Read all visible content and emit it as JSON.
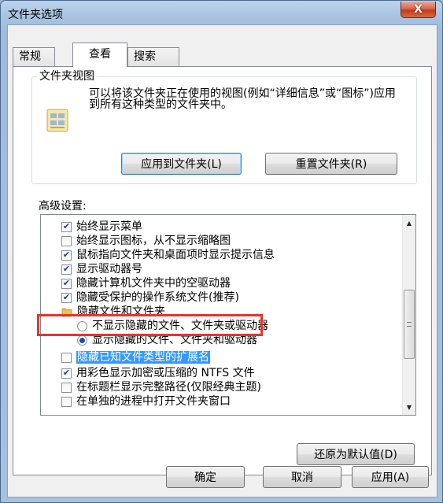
{
  "window": {
    "title": "文件夹选项",
    "close_glyph": "X"
  },
  "tabs": [
    {
      "label": "常规",
      "active": false
    },
    {
      "label": "查看",
      "active": true
    },
    {
      "label": "搜索",
      "active": false
    }
  ],
  "folder_view": {
    "title": "文件夹视图",
    "description": "可以将该文件夹正在使用的视图(例如“详细信息”或“图标”)应用到所有这种类型的文件夹中。",
    "apply_button": "应用到文件夹(L)",
    "reset_button": "重置文件夹(R)"
  },
  "advanced": {
    "label": "高级设置:",
    "items": [
      {
        "type": "checkbox",
        "label": "始终显示菜单",
        "checked": true
      },
      {
        "type": "checkbox",
        "label": "始终显示图标，从不显示缩略图",
        "checked": false
      },
      {
        "type": "checkbox",
        "label": "鼠标指向文件夹和桌面项时显示提示信息",
        "checked": true
      },
      {
        "type": "checkbox",
        "label": "显示驱动器号",
        "checked": true
      },
      {
        "type": "checkbox",
        "label": "隐藏计算机文件夹中的空驱动器",
        "checked": true
      },
      {
        "type": "checkbox",
        "label": "隐藏受保护的操作系统文件(推荐)",
        "checked": true
      },
      {
        "type": "folder",
        "label": "隐藏文件和文件夹"
      },
      {
        "type": "radio",
        "label": "不显示隐藏的文件、文件夹或驱动器",
        "checked": false
      },
      {
        "type": "radio",
        "label": "显示隐藏的文件、文件夹和驱动器",
        "checked": true
      },
      {
        "type": "checkbox",
        "label": "隐藏已知文件类型的扩展名",
        "checked": false,
        "selected": true
      },
      {
        "type": "checkbox",
        "label": "用彩色显示加密或压缩的 NTFS 文件",
        "checked": true
      },
      {
        "type": "checkbox",
        "label": "在标题栏显示完整路径(仅限经典主题)",
        "checked": false
      },
      {
        "type": "checkbox",
        "label": "在单独的进程中打开文件夹窗口",
        "checked": false
      }
    ],
    "restore_button": "还原为默认值(D)"
  },
  "footer": {
    "ok": "确定",
    "cancel": "取消",
    "apply": "应用(A)"
  },
  "colors": {
    "highlight_box": "#e8342b",
    "selection": "#3399ff",
    "checkmark": "#1c3f94"
  }
}
